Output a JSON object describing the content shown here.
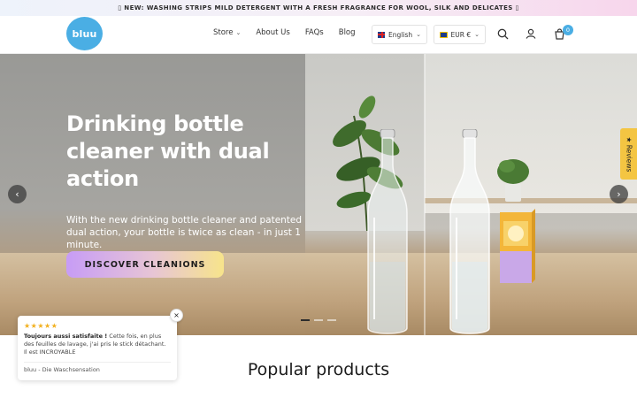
{
  "announcement": "▯ NEW: WASHING STRIPS MILD DETERGENT WITH A FRESH FRAGRANCE FOR WOOL, SILK AND DELICATES ▯",
  "header": {
    "logo_text": "bluu",
    "nav": [
      {
        "label": "Store",
        "has_dropdown": true
      },
      {
        "label": "About Us",
        "has_dropdown": false
      },
      {
        "label": "FAQs",
        "has_dropdown": false
      },
      {
        "label": "Blog",
        "has_dropdown": false
      }
    ],
    "language": "English",
    "currency": "EUR €",
    "cart_count": "0",
    "icons": [
      "search-icon",
      "account-icon",
      "cart-icon"
    ]
  },
  "hero": {
    "title": "Drinking bottle cleaner with dual action",
    "subtitle": "With the new drinking bottle cleaner and patented dual action, your bottle is twice as clean - in just 1 minute.",
    "cta_label": "DISCOVER CLEANIONS",
    "slides_total": 3,
    "active_slide": 1
  },
  "reviews_tab": "★ Reviews",
  "review_card": {
    "stars": "★★★★★",
    "author_line": "Toujours aussi satisfaite !",
    "body": "Cette fois, en plus des feuilles de lavage, j'ai pris le stick détachant. Il est INCROYABLE",
    "source": "bluu - Die Waschsensation",
    "close_label": "×"
  },
  "section_title": "Popular products",
  "colors": {
    "brand_blue": "#4aaee4",
    "cta_start": "#c79cf6",
    "cta_end": "#f7e48b",
    "star": "#f2b01e"
  }
}
